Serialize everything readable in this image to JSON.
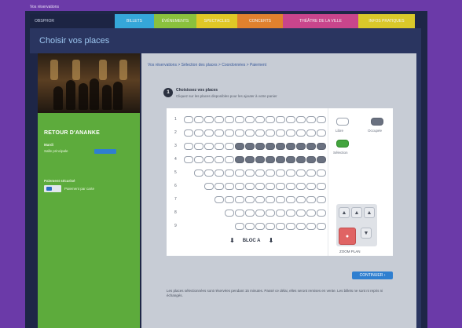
{
  "top_strip": "Vos réservations",
  "nav": {
    "brand": "OBSPHOR",
    "tabs": [
      {
        "label": "BILLETS",
        "color": "#35a7d9",
        "width": 50
      },
      {
        "label": "ÉVÉNEMENTS",
        "color": "#8ac13d",
        "width": 54
      },
      {
        "label": "SPECTACLES",
        "color": "#e0c826",
        "width": 52
      },
      {
        "label": "CONCERTS",
        "color": "#e0812e",
        "width": 58
      },
      {
        "label": "THÉÂTRE DE LA VILLE",
        "color": "#c9458c",
        "width": 96
      },
      {
        "label": "INFOS PRATIQUES",
        "color": "#d9c82a",
        "width": 72
      }
    ]
  },
  "page_title": "Choisir vos places",
  "sidebar": {
    "event_title": "RETOUR D'ANANKE",
    "date": "Mardi",
    "venue": "Salle principale",
    "pay_label": "Paiement sécurisé",
    "pay_text": "Paiement par carte"
  },
  "main": {
    "breadcrumb": "Vos réservations   >   Sélection des places   >   Coordonnées   >   Paiement",
    "step_number": "1",
    "step_title": "Choisissez vos places",
    "step_desc": "Cliquez sur les places disponibles pour les ajouter à votre panier",
    "bloc_label": "BLOC A",
    "legend": {
      "available": "Libre",
      "occupied": "Occupée",
      "selected": "Sélection"
    },
    "zoom_label": "ZOOM PLAN",
    "continue": "CONTINUER ›",
    "footer_note": "Les places sélectionnées sont réservées pendant 15 minutes. Passé ce délai, elles seront remises en vente. Les billets ne sont ni repris ni échangés.",
    "rows": [
      {
        "label": "1",
        "start": 0,
        "count": 14,
        "occupied_from": -1,
        "occupied_to": -1
      },
      {
        "label": "2",
        "start": 0,
        "count": 14,
        "occupied_from": -1,
        "occupied_to": -1
      },
      {
        "label": "3",
        "start": 0,
        "count": 14,
        "occupied_from": 5,
        "occupied_to": 13
      },
      {
        "label": "4",
        "start": 0,
        "count": 14,
        "occupied_from": 5,
        "occupied_to": 13
      },
      {
        "label": "5",
        "start": 1,
        "count": 13,
        "occupied_from": -1,
        "occupied_to": -1
      },
      {
        "label": "6",
        "start": 2,
        "count": 12,
        "occupied_from": -1,
        "occupied_to": -1
      },
      {
        "label": "7",
        "start": 3,
        "count": 11,
        "occupied_from": -1,
        "occupied_to": -1
      },
      {
        "label": "8",
        "start": 4,
        "count": 10,
        "occupied_from": -1,
        "occupied_to": -1
      },
      {
        "label": "9",
        "start": 5,
        "count": 9,
        "occupied_from": -1,
        "occupied_to": -1
      }
    ]
  }
}
